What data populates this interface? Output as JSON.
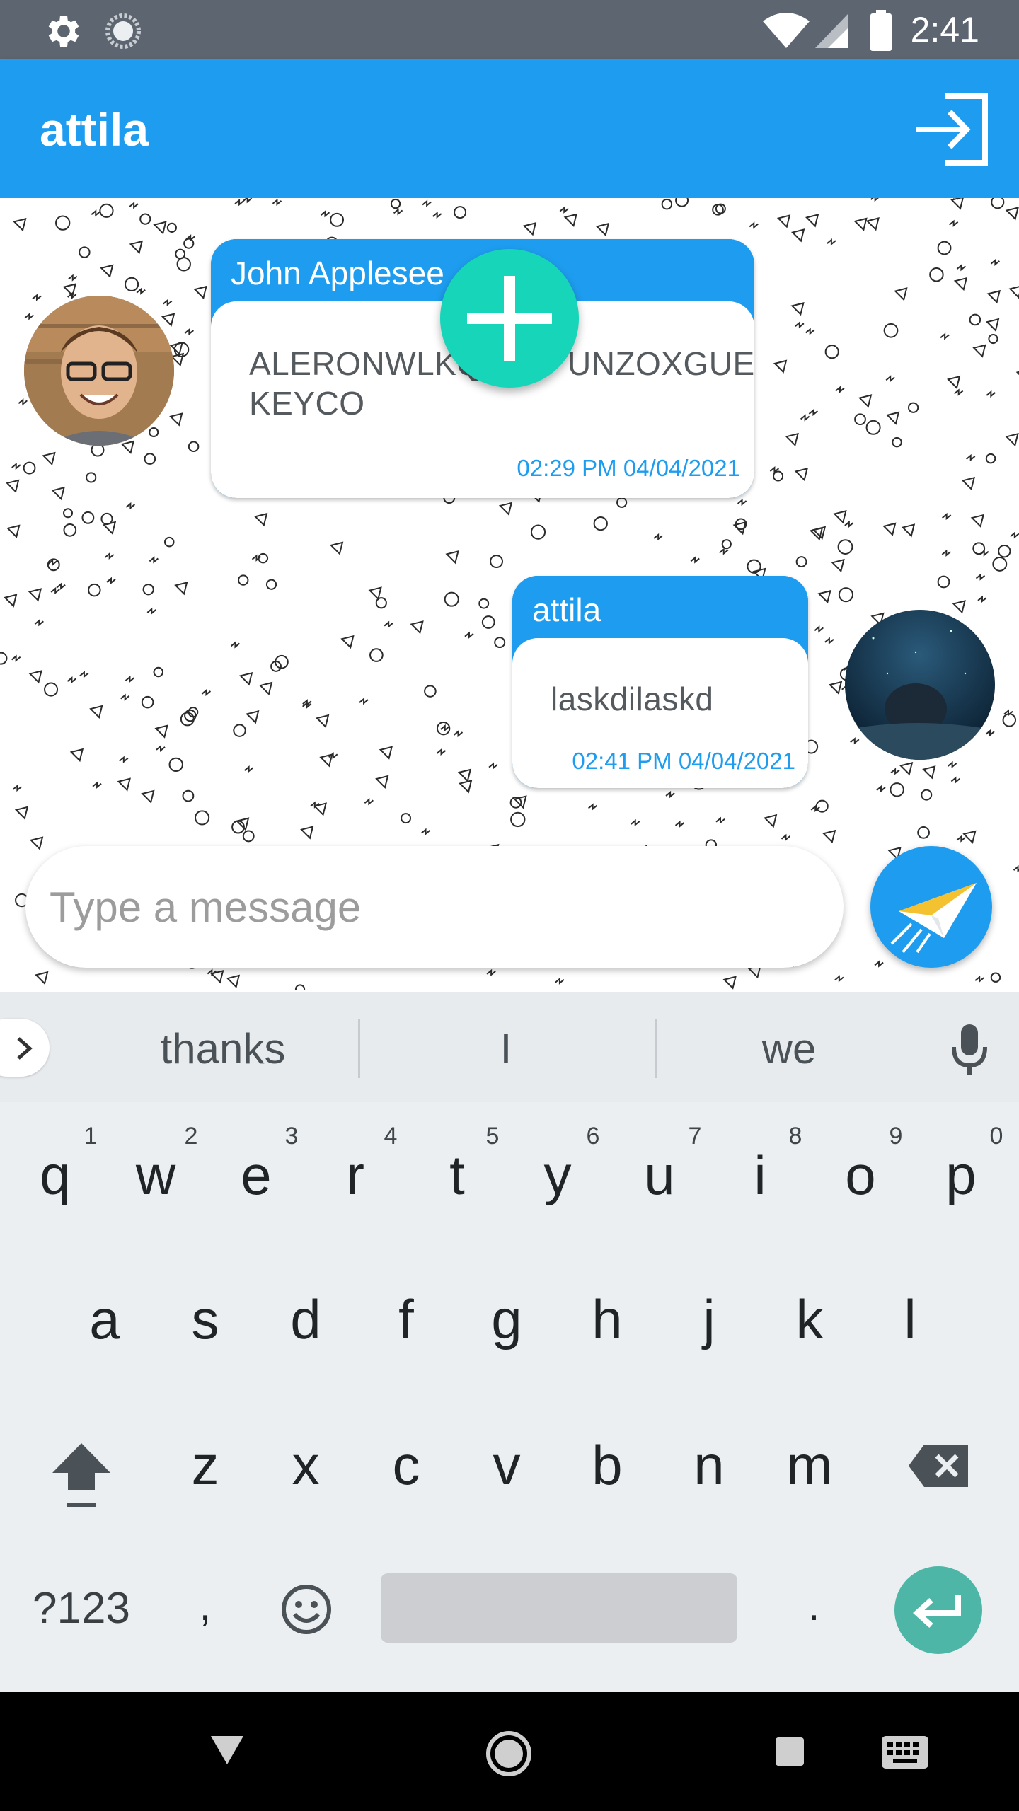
{
  "status_bar": {
    "time": "2:41"
  },
  "app_bar": {
    "title": "attila"
  },
  "messages": [
    {
      "sender": "John Applesee",
      "text_line1": "ALERONWLKQ",
      "text_line1b": "UNZOXGUE",
      "text_line2": "KEYCO",
      "time": "02:29 PM 04/04/2021"
    },
    {
      "sender": "attila",
      "text_line1": "laskdilaskd",
      "time": "02:41 PM 04/04/2021"
    }
  ],
  "composer": {
    "placeholder": "Type a message"
  },
  "keyboard": {
    "suggestions": [
      "thanks",
      "I",
      "we"
    ],
    "row1": [
      "q",
      "w",
      "e",
      "r",
      "t",
      "y",
      "u",
      "i",
      "o",
      "p"
    ],
    "row1_hints": [
      "1",
      "2",
      "3",
      "4",
      "5",
      "6",
      "7",
      "8",
      "9",
      "0"
    ],
    "row2": [
      "a",
      "s",
      "d",
      "f",
      "g",
      "h",
      "j",
      "k",
      "l"
    ],
    "row3": [
      "z",
      "x",
      "c",
      "v",
      "b",
      "n",
      "m"
    ],
    "symbols_label": "?123",
    "comma": ",",
    "period": "."
  },
  "colors": {
    "accent": "#1e9df0",
    "fab": "#17d5b9",
    "enter": "#4db6a6",
    "status_bar": "#5d6570"
  },
  "icons": {
    "status_left": [
      "gear-icon",
      "sync-icon"
    ],
    "status_right": [
      "wifi-icon",
      "cell-signal-icon",
      "battery-icon"
    ],
    "app_bar": "logout-icon",
    "fab": "plus-icon",
    "send": "paper-plane-icon",
    "keyboard": [
      "chevron-right-icon",
      "microphone-icon",
      "shift-icon",
      "backspace-icon",
      "emoji-icon",
      "enter-icon"
    ],
    "nav": [
      "back-triangle-icon",
      "home-circle-icon",
      "recents-square-icon",
      "keyboard-icon"
    ]
  }
}
